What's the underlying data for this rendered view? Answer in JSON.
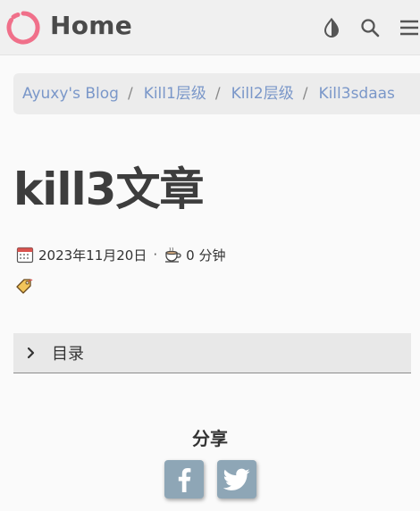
{
  "header": {
    "site_title": "Home",
    "icons": [
      "logo-ring-icon",
      "theme-toggle-icon",
      "search-icon",
      "menu-icon"
    ]
  },
  "breadcrumb": {
    "items": [
      "Ayuxy's Blog",
      "Kill1层级",
      "Kill2层级",
      "Kill3sdaas"
    ],
    "separator": "/"
  },
  "article": {
    "title": "kill3文章",
    "date": "2023年11月20日",
    "meta_separator": "·",
    "reading_time": "0 分钟"
  },
  "toc": {
    "label": "目录"
  },
  "share": {
    "title": "分享",
    "buttons": [
      "facebook",
      "twitter"
    ]
  },
  "colors": {
    "logo": "#f0708a",
    "link": "#7a97c9",
    "share_button": "#8ea6b6",
    "title": "#3d3d3d"
  }
}
